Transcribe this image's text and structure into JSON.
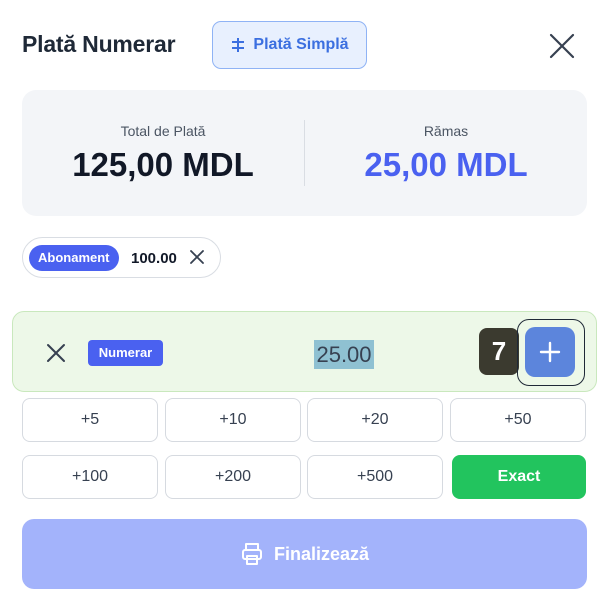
{
  "header": {
    "title": "Plată Numerar",
    "mode_button_label": "Plată Simplă",
    "mode_button_icon": "split-icon",
    "close_icon": "close-icon"
  },
  "summary": {
    "total_label": "Total de Plată",
    "total_value": "125,00 MDL",
    "remaining_label": "Rămas",
    "remaining_value": "25,00 MDL",
    "remaining_color": "#4a61f0"
  },
  "applied": [
    {
      "badge": "Abonament",
      "amount": "100.00"
    }
  ],
  "payment_row": {
    "method": "Numerar",
    "amount": "25.00",
    "marker": "7"
  },
  "quick_amounts": [
    "+5",
    "+10",
    "+20",
    "+50",
    "+100",
    "+200",
    "+500"
  ],
  "exact_label": "Exact",
  "finalize_label": "Finalizează",
  "colors": {
    "accent": "#4a61f0",
    "success": "#22c45e",
    "finalize_disabled": "#a3b3fb"
  }
}
